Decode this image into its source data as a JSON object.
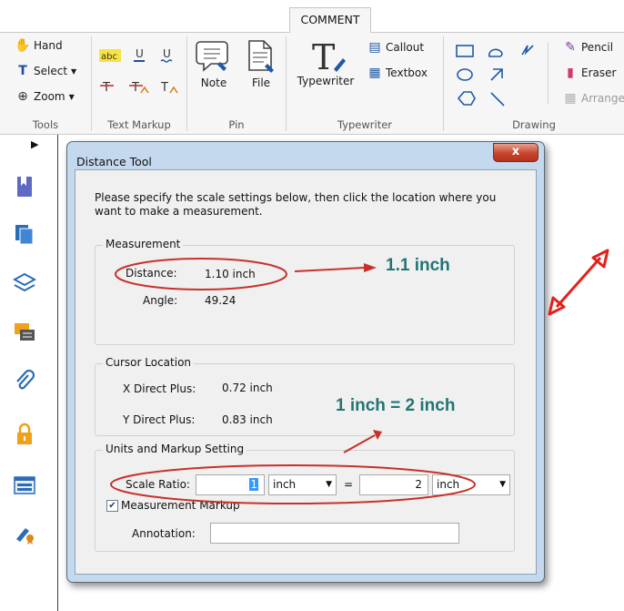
{
  "ribbon": {
    "active_tab": "COMMENT",
    "groups": {
      "tools": {
        "label": "Tools",
        "hand": "Hand",
        "select": "Select",
        "zoom": "Zoom"
      },
      "text_markup": {
        "label": "Text Markup"
      },
      "pin": {
        "label": "Pin",
        "note": "Note",
        "file": "File"
      },
      "typewriter": {
        "label": "Typewriter",
        "typewriter": "Typewriter",
        "callout": "Callout",
        "textbox": "Textbox"
      },
      "drawing": {
        "label": "Drawing",
        "pencil": "Pencil",
        "eraser": "Eraser",
        "arrange": "Arrange"
      }
    }
  },
  "dialog": {
    "title": "Distance Tool",
    "close": "x",
    "intro": "Please specify the scale settings below, then click the location where you want to make a measurement.",
    "measurement": {
      "title": "Measurement",
      "distance_label": "Distance:",
      "distance_value": "1.10 inch",
      "angle_label": "Angle:",
      "angle_value": "49.24"
    },
    "cursor": {
      "title": "Cursor Location",
      "x_label": "X Direct Plus:",
      "x_value": "0.72 inch",
      "y_label": "Y Direct Plus:",
      "y_value": "0.83 inch"
    },
    "units": {
      "title": "Units and Markup Setting",
      "scale_label": "Scale Ratio:",
      "scale_from_value": "1",
      "scale_from_unit": "inch",
      "equals": "=",
      "scale_to_value": "2",
      "scale_to_unit": "inch",
      "markup_label": "Measurement Markup",
      "markup_checked": true,
      "annotation_label": "Annotation:",
      "annotation_value": ""
    }
  },
  "annotations": {
    "callout_distance": "1.1 inch",
    "callout_scale": "1 inch = 2 inch",
    "color_text": "#217575",
    "color_red": "#d6271f"
  }
}
